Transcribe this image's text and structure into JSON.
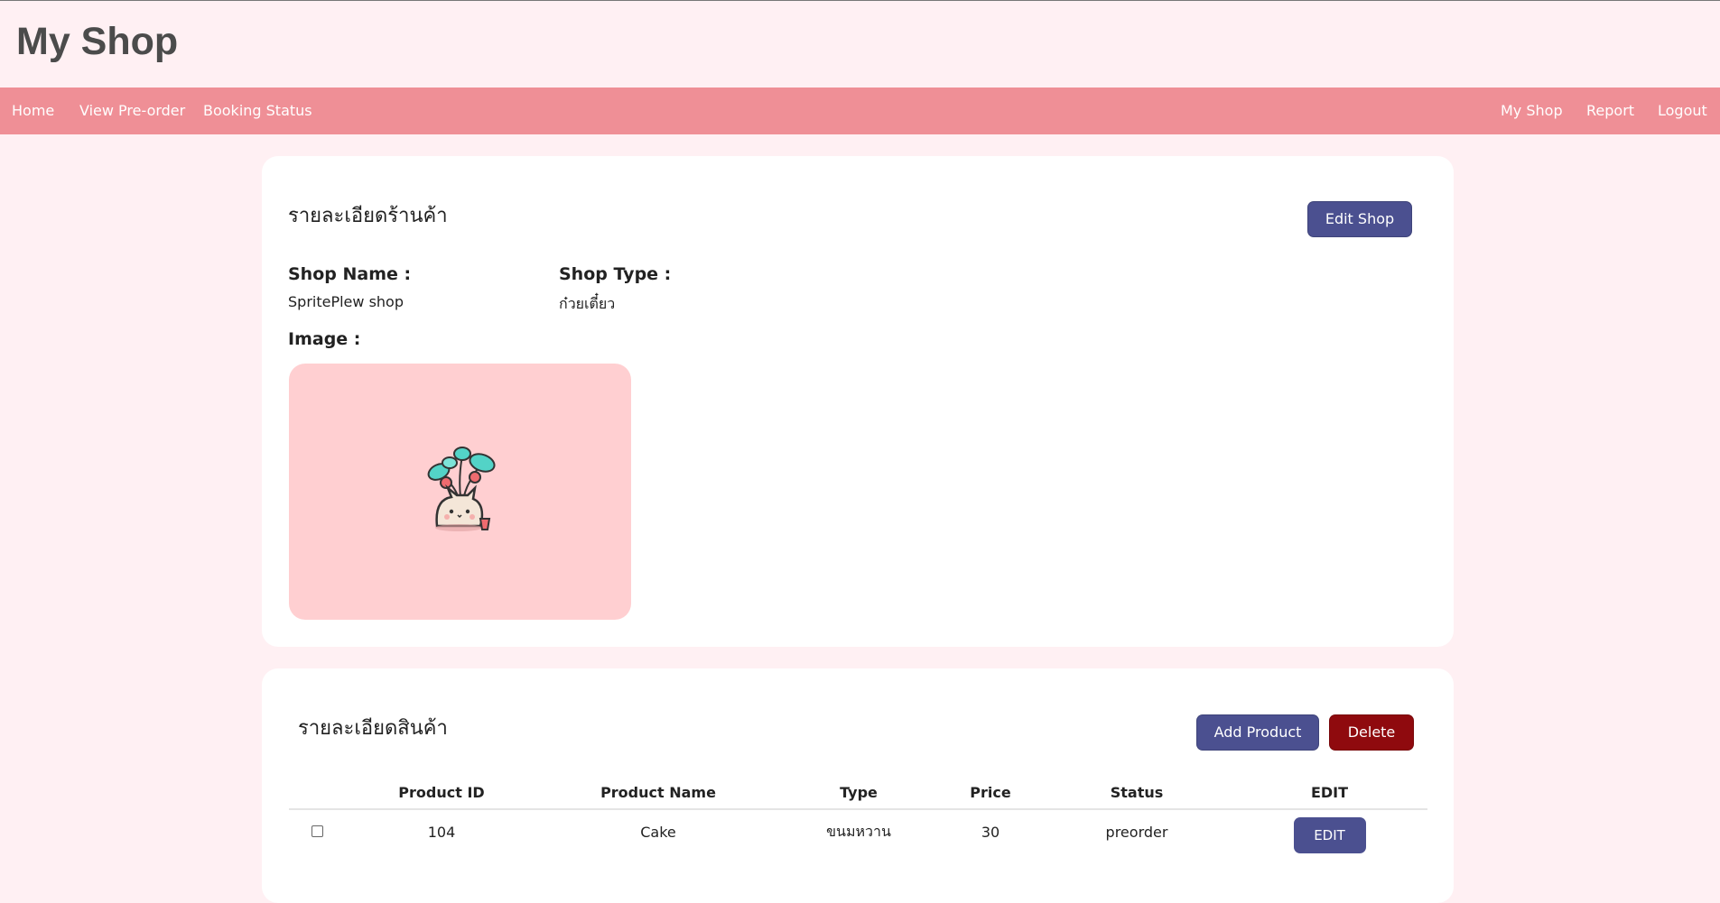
{
  "header": {
    "title": "My Shop"
  },
  "nav": {
    "left": [
      "Home",
      "View Pre-order",
      "Booking Status"
    ],
    "right": [
      "My Shop",
      "Report",
      "Logout"
    ]
  },
  "shop_section": {
    "title": "รายละเอียดร้านค้า",
    "edit_button": "Edit Shop",
    "shop_name_label": "Shop Name :",
    "shop_name_value": "SpritePlew shop",
    "shop_type_label": "Shop Type :",
    "shop_type_value": "ก๋วยเตี๋ยว",
    "image_label": "Image :"
  },
  "product_section": {
    "title": "รายละเอียดสินค้า",
    "add_button": "Add Product",
    "delete_button": "Delete",
    "columns": [
      "",
      "Product ID",
      "Product Name",
      "Type",
      "Price",
      "Status",
      "EDIT"
    ],
    "rows": [
      {
        "id": "104",
        "name": "Cake",
        "type": "ขนมหวาน",
        "price": "30",
        "status": "preorder",
        "edit": "EDIT"
      }
    ]
  },
  "colors": {
    "page_bg": "#fff0f3",
    "navbar": "#ef8f96",
    "primary_button": "#4b5090",
    "danger_button": "#8f0a0e",
    "image_bg": "#ffcfd1"
  },
  "icons": {
    "shop_image": "cat-with-plant-illustration"
  }
}
